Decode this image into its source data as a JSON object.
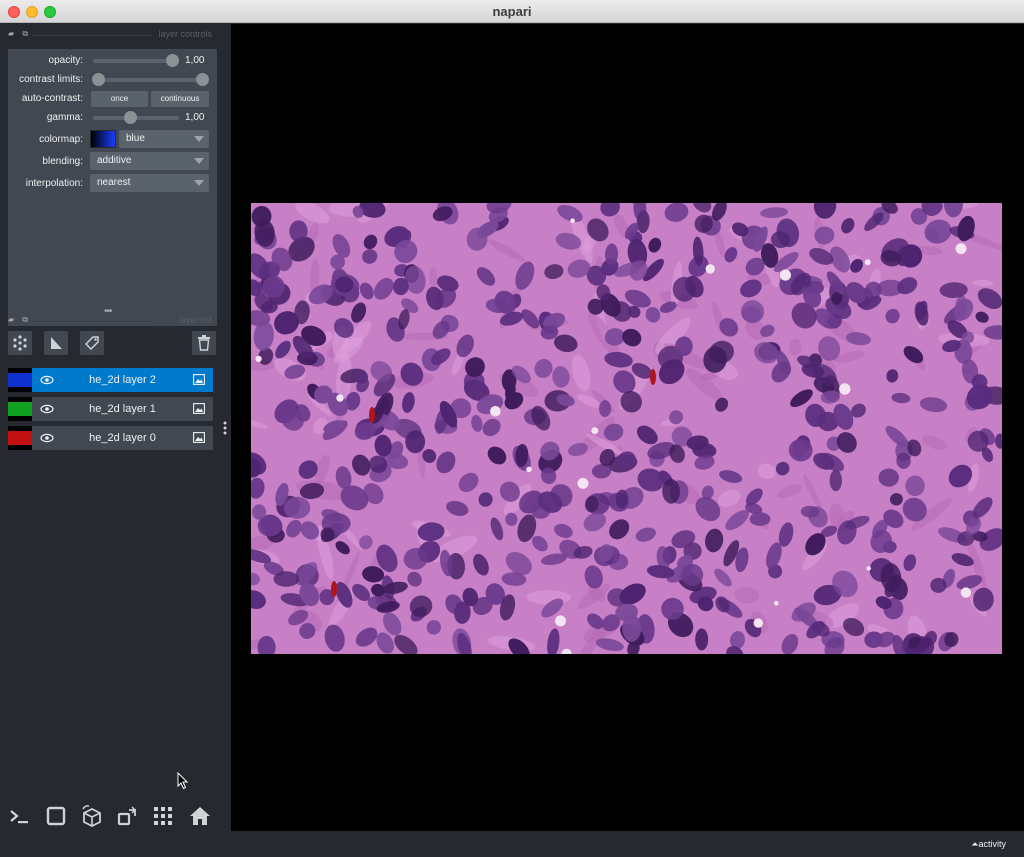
{
  "window": {
    "title": "napari"
  },
  "layer_controls": {
    "header_title": "layer controls",
    "opacity": {
      "label": "opacity:",
      "value": "1,00"
    },
    "contrast_limits": {
      "label": "contrast limits:"
    },
    "auto_contrast": {
      "label": "auto-contrast:",
      "once_label": "once",
      "continuous_label": "continuous"
    },
    "gamma": {
      "label": "gamma:",
      "value": "1,00"
    },
    "colormap": {
      "label": "colormap:",
      "value": "blue"
    },
    "blending": {
      "label": "blending:",
      "value": "additive"
    },
    "interpolation": {
      "label": "interpolation:",
      "value": "nearest"
    }
  },
  "layer_list": {
    "header_title": "layer list",
    "layers": [
      {
        "name": "he_2d layer 2",
        "color": "#1030d0",
        "selected": true
      },
      {
        "name": "he_2d layer 1",
        "color": "#10a020",
        "selected": false
      },
      {
        "name": "he_2d layer 0",
        "color": "#c01010",
        "selected": false
      }
    ]
  },
  "status": {
    "activity_label": "activity"
  },
  "colors": {
    "accent": "#007acc",
    "panel": "#414851",
    "background": "#262930"
  }
}
